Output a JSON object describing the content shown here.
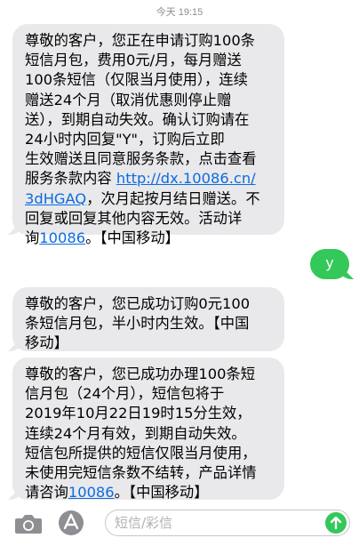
{
  "header": {
    "timestamp": "今天 19:15"
  },
  "messages": {
    "msg1": {
      "lines": [
        "尊敬的客户，您正在申请订购100条",
        "短信月包，费用0元/月，每月赠送",
        "100条短信（仅限当月使用），连续",
        "赠送24个月（取消优惠则停止赠",
        "送），到期自动失效。确认订购请在",
        "24小时内回复\"Y\"，订购后立即",
        "生效赠送且同意服务条款，点击查看",
        "服务条款内容 "
      ],
      "link1": "http://dx.10086.cn/",
      "link1_cont": "3dHGAQ",
      "after_link1": "，次月起按月结日赠送。不",
      "line_10": "回复或回复其他内容无效。活动详",
      "line_11_pre": "询",
      "link2": "10086",
      "line_11_post": "。【中国移动】"
    },
    "reply": "y",
    "msg2": {
      "lines": [
        "尊敬的客户，您已成功订购0元100",
        "条短信月包，半小时内生效。【中国",
        "移动】"
      ]
    },
    "msg3": {
      "lines": [
        "尊敬的客户，您已成功办理100条短",
        "信月包（24个月），短信包将于",
        "2019年10月22日19时15分生效，",
        "连续24个月有效，到期自动失效。",
        "短信包所提供的短信仅限当月使用，",
        "未使用完短信条数不结转，产品详情"
      ],
      "last_pre": "请咨询",
      "link": "10086",
      "last_post": "。【中国移动】"
    }
  },
  "composer": {
    "placeholder": "短信/彩信",
    "camera_icon": "camera-icon",
    "apps_icon": "app-store-icon",
    "send_icon": "send-arrow-icon"
  },
  "colors": {
    "incoming": "#e9e9eb",
    "outgoing": "#34c759",
    "link": "#0b6ce0"
  }
}
